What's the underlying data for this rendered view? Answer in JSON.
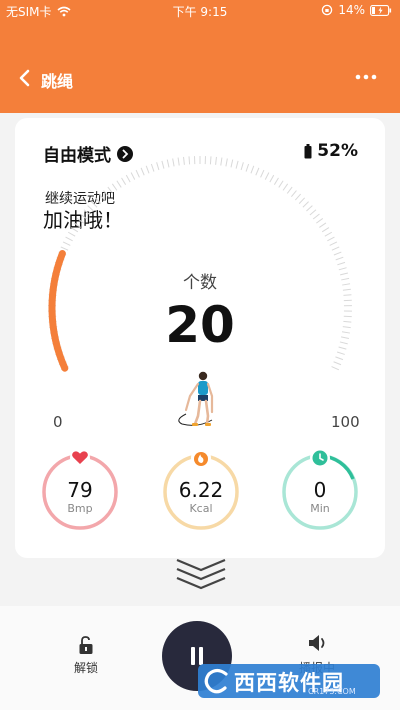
{
  "status_bar": {
    "carrier": "无SIM卡",
    "time": "下午 9:15",
    "battery": "14%"
  },
  "nav": {
    "title": "跳绳"
  },
  "card": {
    "mode_label": "自由模式",
    "device_battery": "52%",
    "encourage_line1": "继续运动吧",
    "encourage_line2": "加油哦！",
    "count_label": "个数",
    "count_value": "20",
    "gauge_min": "0",
    "gauge_max": "100",
    "gauge_progress": 0.2
  },
  "stats": [
    {
      "value": "79",
      "unit": "Bmp",
      "color": "#f3a7ab",
      "icon": "heart-icon"
    },
    {
      "value": "6.22",
      "unit": "Kcal",
      "color": "#f7d9a6",
      "icon": "fire-icon"
    },
    {
      "value": "0",
      "unit": "Min",
      "color": "#a9e6d6",
      "icon": "clock-icon"
    }
  ],
  "bottom": {
    "unlock_label": "解锁",
    "speak_label": "播报中"
  },
  "watermark": {
    "text": "西西软件园",
    "sub": "CR173.COM"
  },
  "colors": {
    "accent": "#f47f3a",
    "pause_button": "#28293c"
  }
}
